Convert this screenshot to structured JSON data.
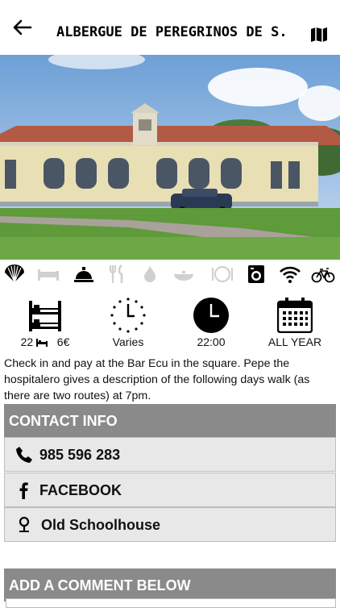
{
  "header": {
    "title": "ALBERGUE DE PEREGRINOS DE S..."
  },
  "amenities": [
    "shell-icon",
    "bed-icon",
    "service-bell-icon",
    "cutlery-icon",
    "fire-icon",
    "dish-icon",
    "plate-icon",
    "washing-machine-icon",
    "wifi-icon",
    "bicycle-icon"
  ],
  "stats": {
    "beds": "22",
    "price": "6€",
    "checkin": "Varies",
    "curfew": "22:00",
    "season": "ALL YEAR"
  },
  "description": "Check in and pay at the Bar Ecu in the square. Pepe the hospitalero gives a description of the following days walk (as there are two routes) at 7pm.",
  "contact": {
    "heading": "CONTACT INFO",
    "phone": "985 596 283",
    "facebook": "FACEBOOK",
    "location": "Old Schoolhouse"
  },
  "comments": {
    "heading": "ADD A COMMENT BELOW"
  },
  "colors": {
    "section_header": "#8a8a8a",
    "row_bg": "#e8e8e8",
    "inactive_icon": "#d0d0d0"
  }
}
